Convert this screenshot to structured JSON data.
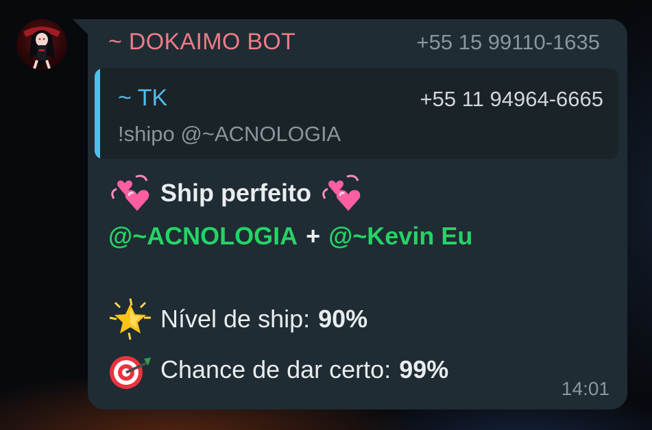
{
  "sender": {
    "name": "~ DOKAIMO BOT",
    "phone": "+55 15 99110-1635",
    "name_color": "#f07b87"
  },
  "quote": {
    "name": "~ TK",
    "phone": "+55 11 94964-6665",
    "text": "!shipo @~ACNOLOGIA",
    "accent_color": "#53bdeb"
  },
  "message": {
    "title": "Ship perfeito",
    "title_icon": "revolving-hearts-icon",
    "mention_1": "@~ACNOLOGIA",
    "plus": "+",
    "mention_2": "@~Kevin Eu",
    "level_icon": "glowing-star-icon",
    "level_label": "Nível de ship:",
    "level_value": "90%",
    "chance_icon": "direct-hit-icon",
    "chance_label": "Chance de dar certo:",
    "chance_value": "99%",
    "mention_color": "#25d366"
  },
  "time": "14:01",
  "colors": {
    "bubble": "#1f2c33",
    "quote_bg": "#1a2328",
    "text": "#e9edef",
    "muted": "#8a969d"
  }
}
